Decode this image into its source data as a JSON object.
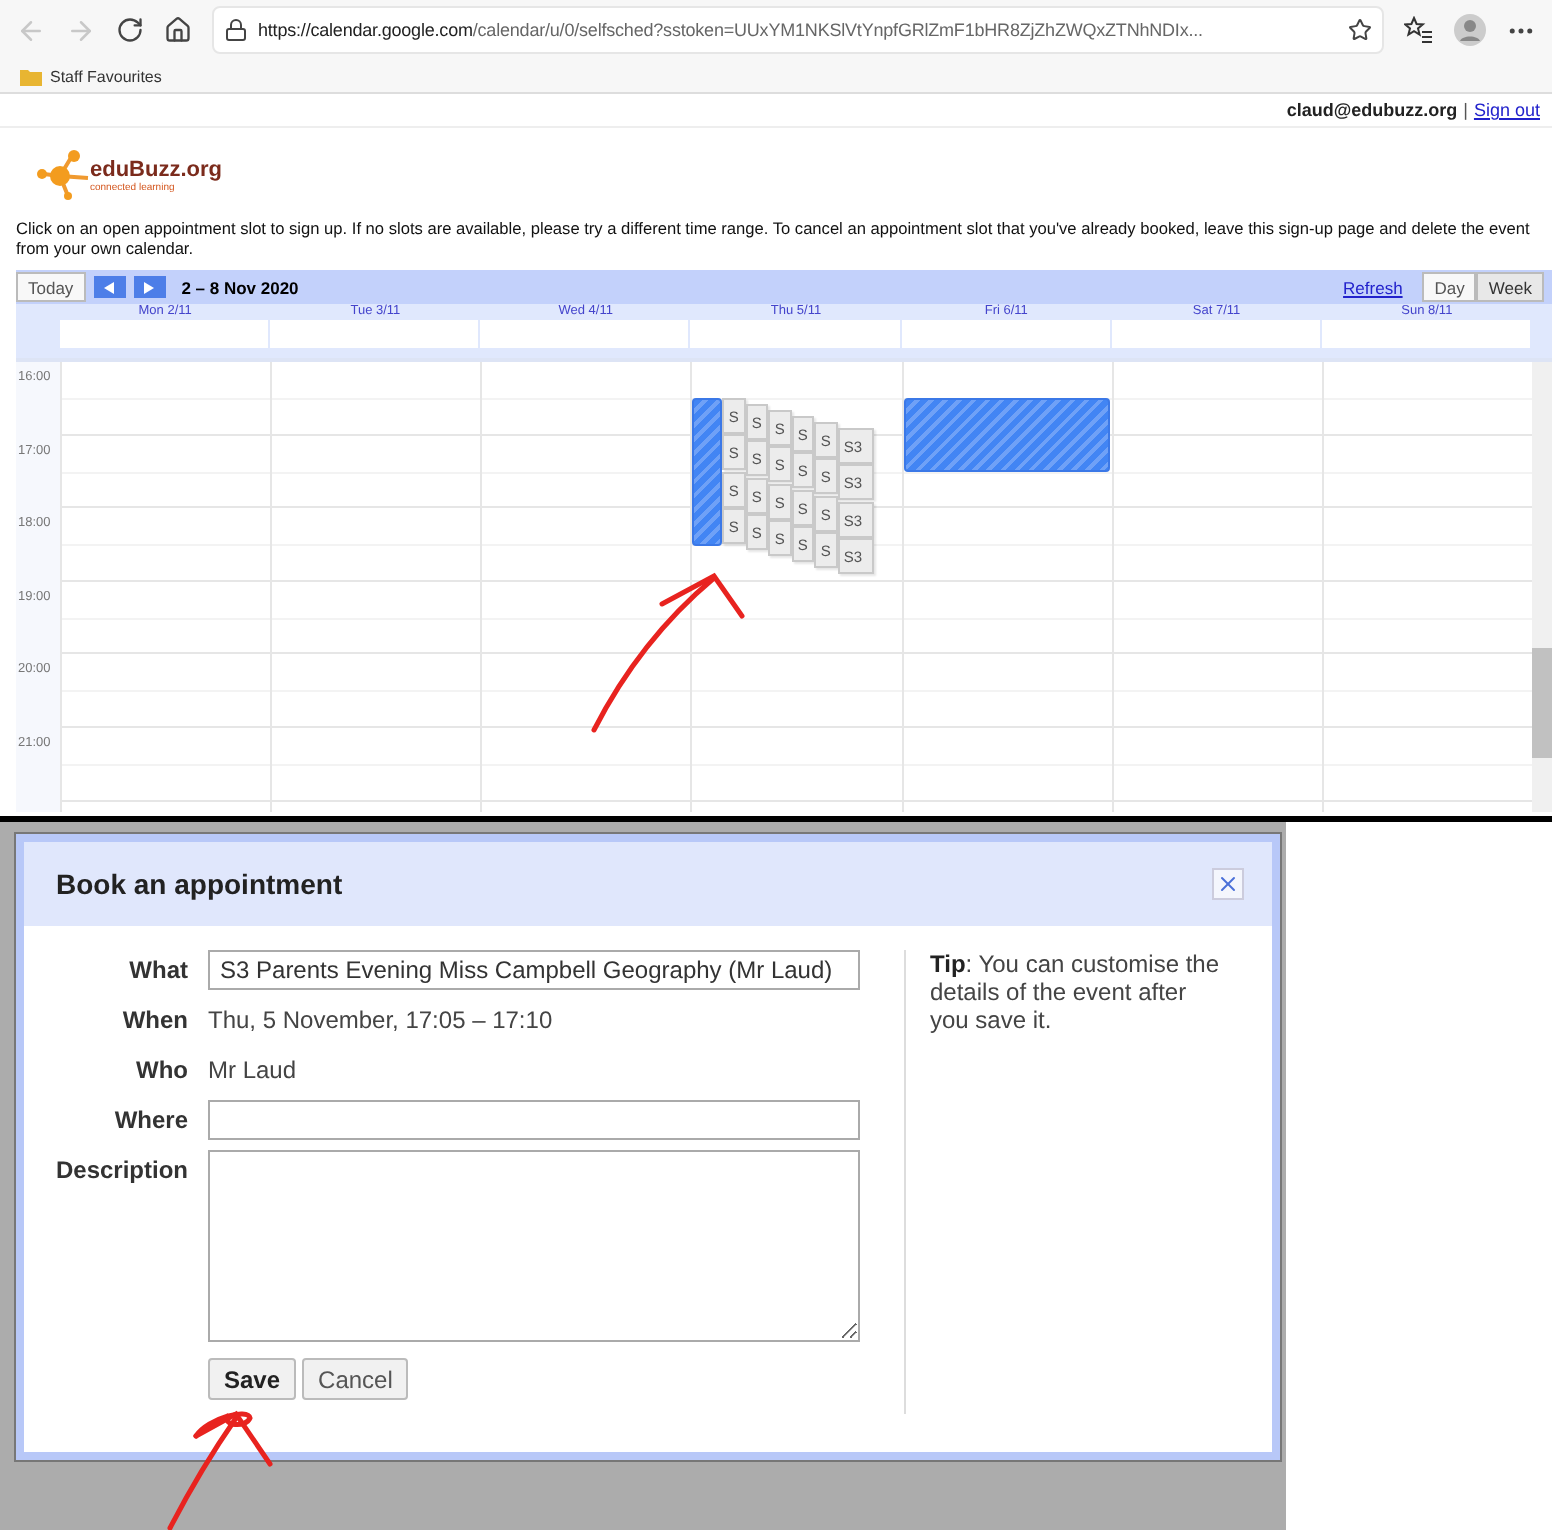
{
  "browser": {
    "url_host": "https://calendar.google.com",
    "url_path": "/calendar/u/0/selfsched?sstoken=UUxYM1NKSlVtYnpfGRlZmF1bHR8ZjZhZWQxZTNhNDIx...",
    "bookmarks": [
      {
        "label": "Staff Favourites"
      }
    ]
  },
  "account": {
    "email": "claud@edubuzz.org",
    "separator": "|",
    "sign_out": "Sign out"
  },
  "logo": {
    "name": "eduBuzz.org",
    "tagline": "connected learning"
  },
  "instructions": "Click on an open appointment slot to sign up. If no slots are available, please try a different time range. To cancel an appointment slot that you've already booked, leave this sign-up page and delete the event from your own calendar.",
  "calendar": {
    "today": "Today",
    "range": "2 – 8 Nov 2020",
    "refresh": "Refresh",
    "views": [
      {
        "label": "Day",
        "selected": false
      },
      {
        "label": "Week",
        "selected": true
      }
    ],
    "hours": [
      "16:00",
      "17:00",
      "18:00",
      "19:00",
      "20:00",
      "21:00"
    ],
    "days": [
      {
        "label": "Mon 2/11",
        "busy": false
      },
      {
        "label": "Tue 3/11",
        "busy": false
      },
      {
        "label": "Wed 4/11",
        "busy": false
      },
      {
        "label": "Thu 5/11",
        "busy": true,
        "slot_columns": [
          [
            "S",
            "S",
            "S",
            "S"
          ],
          [
            "S",
            "S",
            "S",
            "S"
          ],
          [
            "S",
            "S",
            "S",
            "S"
          ],
          [
            "S",
            "S",
            "S",
            "S"
          ],
          [
            "S",
            "S",
            "S",
            "S"
          ],
          [
            "S3",
            "S3",
            "S3",
            "S3"
          ]
        ]
      },
      {
        "label": "Fri 6/11",
        "busy": true
      },
      {
        "label": "Sat 7/11",
        "busy": false
      },
      {
        "label": "Sun 8/11",
        "busy": false
      }
    ]
  },
  "dialog": {
    "title": "Book an appointment",
    "fields": [
      {
        "label": "What",
        "kind": "input",
        "value": "S3 Parents Evening Miss Campbell Geography (Mr Laud)"
      },
      {
        "label": "When",
        "kind": "text",
        "value": "Thu, 5 November, 17:05 – 17:10"
      },
      {
        "label": "Who",
        "kind": "text",
        "value": "Mr Laud"
      },
      {
        "label": "Where",
        "kind": "input"
      },
      {
        "label": "Description",
        "kind": "textarea"
      }
    ],
    "buttons": [
      {
        "label": "Save",
        "primary": true
      },
      {
        "label": "Cancel",
        "primary": false
      }
    ],
    "tip": "**Tip**: You can customise the details of the event after you save it."
  }
}
